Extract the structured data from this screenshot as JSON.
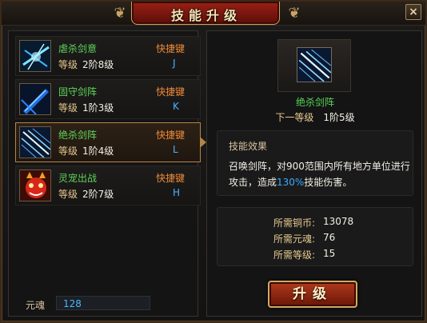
{
  "window": {
    "title": "技能升级",
    "close_label": "×"
  },
  "skills": [
    {
      "name": "虐杀剑意",
      "level_label": "等级",
      "level_value": "2阶8级",
      "hotkey_label": "快捷键",
      "hotkey": "J",
      "icon": "slash-burst-icon",
      "selected": false
    },
    {
      "name": "固守剑阵",
      "level_label": "等级",
      "level_value": "1阶3级",
      "hotkey_label": "快捷键",
      "hotkey": "K",
      "icon": "blue-sword-icon",
      "selected": false
    },
    {
      "name": "绝杀剑阵",
      "level_label": "等级",
      "level_value": "1阶4级",
      "hotkey_label": "快捷键",
      "hotkey": "L",
      "icon": "sword-rain-icon",
      "selected": true
    },
    {
      "name": "灵宠出战",
      "level_label": "等级",
      "level_value": "2阶7级",
      "hotkey_label": "快捷键",
      "hotkey": "H",
      "icon": "demon-pet-icon",
      "selected": false
    }
  ],
  "yuanhun": {
    "label": "元魂",
    "value": "128"
  },
  "detail": {
    "name": "绝杀剑阵",
    "next_level_label": "下一等级",
    "next_level_value": "1阶5级",
    "effect_title": "技能效果",
    "effect_desc_prefix": "召唤剑阵，对900范围内所有地方单位进行攻击，造成",
    "effect_desc_highlight": "130%",
    "effect_desc_suffix": "技能伤害。",
    "requirements": [
      {
        "label": "所需铜币:",
        "value": "13078"
      },
      {
        "label": "所需元魂:",
        "value": "76"
      },
      {
        "label": "所需等级:",
        "value": "15"
      }
    ],
    "upgrade_label": "升级"
  },
  "colors": {
    "skill_name": "#5fd35a",
    "hotkey_label": "#f08a38",
    "hotkey_value": "#4fb2ff",
    "highlight": "#3aa9ff",
    "frame_gold": "#b48445"
  }
}
